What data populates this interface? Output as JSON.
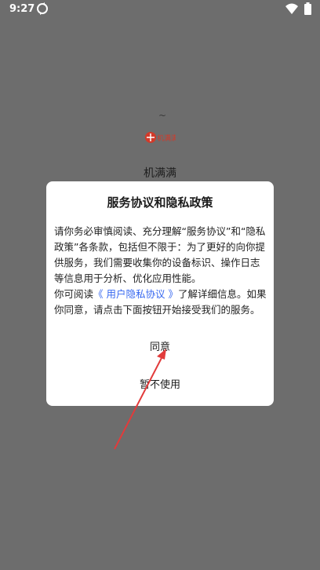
{
  "status_bar": {
    "time": "9:27",
    "icons": [
      "sync-icon",
      "wifi-icon",
      "battery-icon"
    ]
  },
  "splash": {
    "tilde": "~",
    "logo_text": "机满满",
    "app_name": "机满满",
    "logo_color": "#d23a2a"
  },
  "dialog": {
    "title": "服务协议和隐私政策",
    "body_part1": "请你务必审慎阅读、充分理解“服务协议”和“隐私政策”各条款，包括但不限于：为了更好的向你提供服务，我们需要收集你的设备标识、操作日志等信息用于分析、优化应用性能。",
    "body_part2_prefix": "你可阅读",
    "link_text": "《 用户隐私协议 》",
    "body_part2_suffix": "了解详细信息。如果你同意，请点击下面按钮开始接受我们的服务。",
    "agree_label": "同意",
    "decline_label": "暂不使用"
  },
  "colors": {
    "overlay": "#6d6d6d",
    "link": "#3768f0",
    "arrow": "#e23b3b"
  }
}
